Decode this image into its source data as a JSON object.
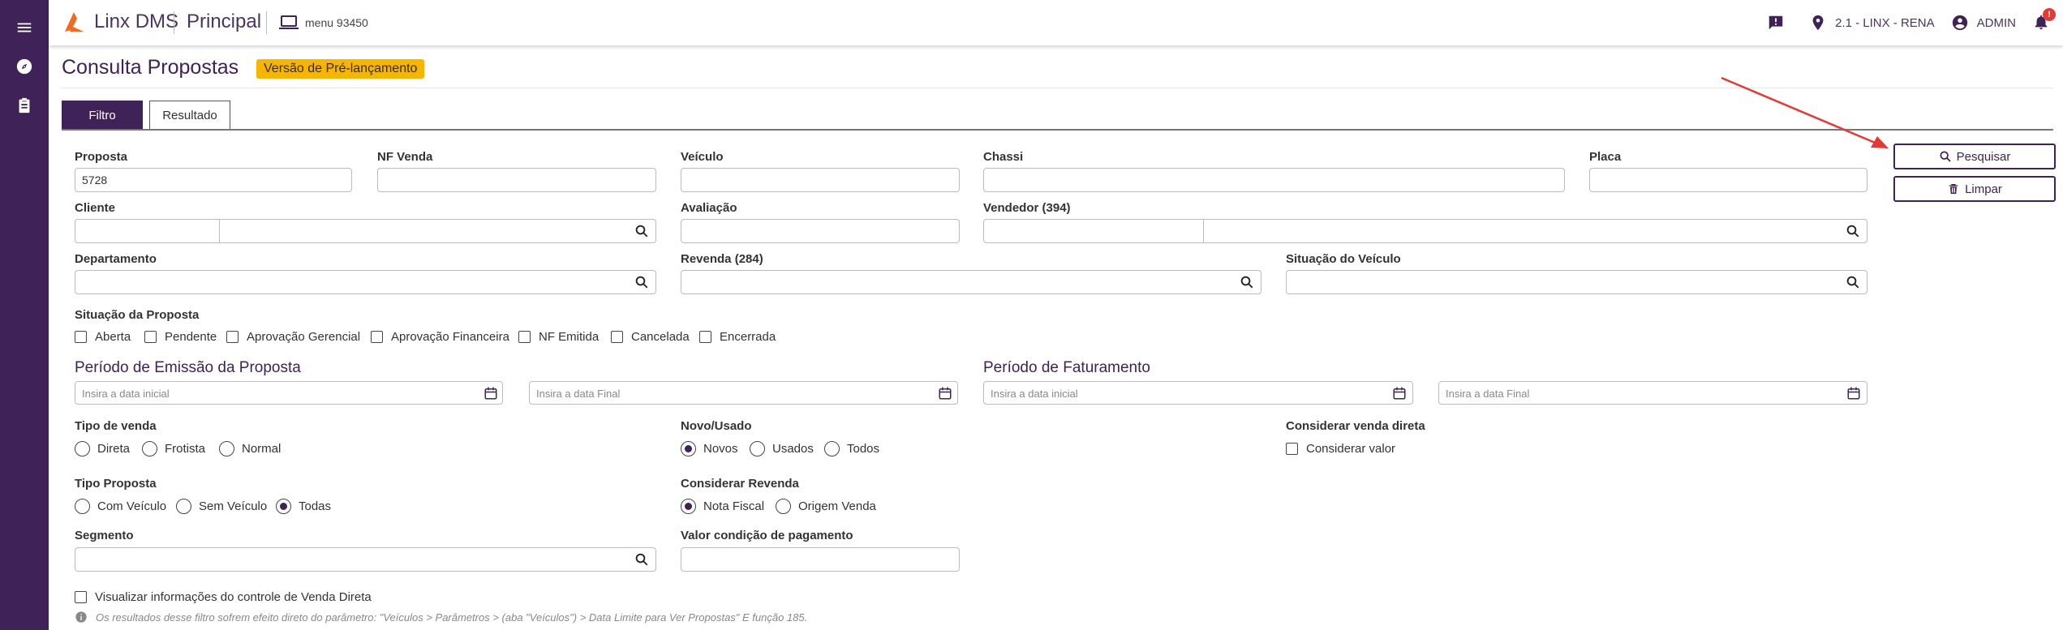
{
  "topbar": {
    "brand": "Linx DMS",
    "module": "Principal",
    "menu_code": "menu 93450",
    "location": "2.1 - LINX - RENA",
    "user": "ADMIN",
    "notification_badge": "!"
  },
  "page": {
    "title": "Consulta Propostas",
    "badge": "Versão de Pré-lançamento"
  },
  "tabs": {
    "filtro": "Filtro",
    "resultado": "Resultado"
  },
  "fields": {
    "proposta_label": "Proposta",
    "proposta_value": "5728",
    "nf_venda_label": "NF Venda",
    "veiculo_label": "Veículo",
    "chassi_label": "Chassi",
    "placa_label": "Placa",
    "cliente_label": "Cliente",
    "avaliacao_label": "Avaliação",
    "vendedor_label": "Vendedor (394)",
    "departamento_label": "Departamento",
    "revenda_label": "Revenda (284)",
    "situacao_veiculo_label": "Situação do Veículo",
    "segmento_label": "Segmento",
    "valor_condicao_label": "Valor condição de pagamento"
  },
  "situacao_proposta": {
    "label": "Situação da Proposta",
    "options": [
      "Aberta",
      "Pendente",
      "Aprovação Gerencial",
      "Aprovação Financeira",
      "NF Emitida",
      "Cancelada",
      "Encerrada"
    ]
  },
  "periodo_emissao": {
    "title": "Período de Emissão da Proposta",
    "start_placeholder": "Insira a data inicial",
    "end_placeholder": "Insira a data Final"
  },
  "periodo_faturamento": {
    "title": "Período de Faturamento",
    "start_placeholder": "Insira a data inicial",
    "end_placeholder": "Insira a data Final"
  },
  "tipo_venda": {
    "label": "Tipo de venda",
    "options": [
      "Direta",
      "Frotista",
      "Normal"
    ],
    "selected": null
  },
  "novo_usado": {
    "label": "Novo/Usado",
    "options": [
      "Novos",
      "Usados",
      "Todos"
    ],
    "selected": "Novos"
  },
  "considerar_venda_direta": {
    "label": "Considerar venda direta",
    "checkbox_label": "Considerar valor"
  },
  "tipo_proposta": {
    "label": "Tipo Proposta",
    "options": [
      "Com Veículo",
      "Sem Veículo",
      "Todas"
    ],
    "selected": "Todas"
  },
  "considerar_revenda": {
    "label": "Considerar Revenda",
    "options": [
      "Nota Fiscal",
      "Origem Venda"
    ],
    "selected": "Nota Fiscal"
  },
  "visualizar_label": "Visualizar informações do controle de Venda Direta",
  "info_text": "Os resultados desse filtro sofrem efeito direto do parâmetro: \"Veículos > Parâmetros > (aba \"Veículos\") > Data Limite para Ver Propostas\" E função 185.",
  "buttons": {
    "pesquisar": "Pesquisar",
    "limpar": "Limpar"
  },
  "colors": {
    "primary": "#3f2257",
    "badge": "#f6b600",
    "logo": "#f26a21",
    "arrow": "#e53935"
  }
}
